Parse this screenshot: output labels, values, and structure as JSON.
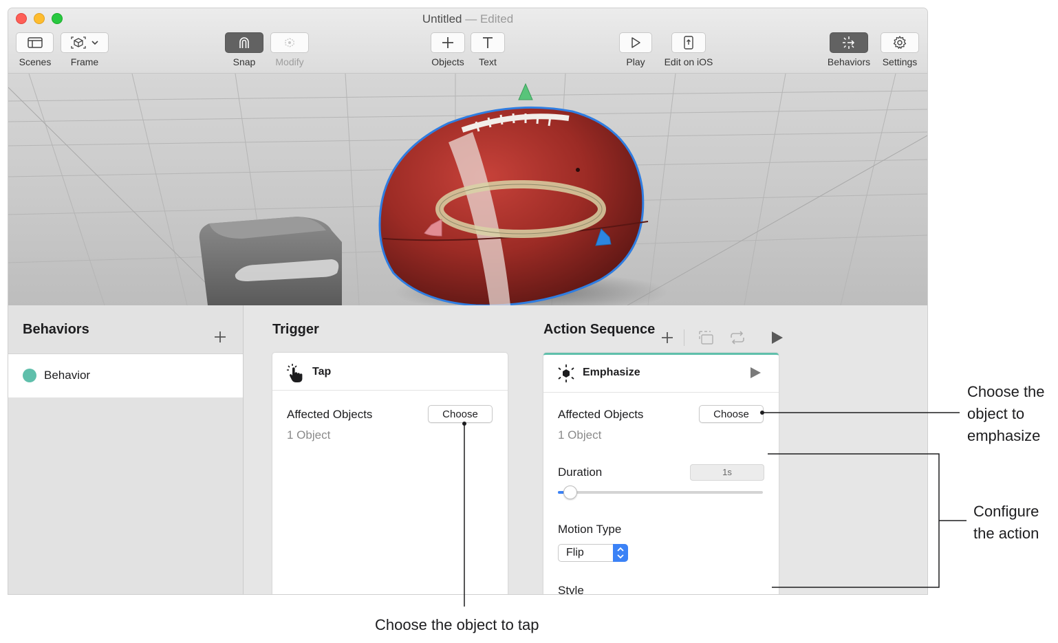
{
  "window": {
    "title": "Untitled",
    "title_suffix": "— Edited"
  },
  "toolbar": {
    "scenes": "Scenes",
    "frame": "Frame",
    "snap": "Snap",
    "modify": "Modify",
    "objects": "Objects",
    "text": "Text",
    "play": "Play",
    "edit_on_ios": "Edit on iOS",
    "behaviors": "Behaviors",
    "settings": "Settings"
  },
  "behaviors_panel": {
    "title": "Behaviors",
    "items": [
      {
        "label": "Behavior",
        "color": "#5fbfab"
      }
    ]
  },
  "trigger": {
    "title": "Trigger",
    "card_title": "Tap",
    "affected_label": "Affected Objects",
    "choose": "Choose",
    "count": "1 Object"
  },
  "action_sequence": {
    "title": "Action Sequence",
    "card_title": "Emphasize",
    "affected_label": "Affected Objects",
    "choose": "Choose",
    "count": "1 Object",
    "duration_label": "Duration",
    "duration_value": "1s",
    "duration_slider_fraction": 0.03,
    "motion_label": "Motion Type",
    "motion_value": "Flip",
    "style_label": "Style",
    "accent": "#5fbfab"
  },
  "callouts": {
    "choose_emphasize": [
      "Choose the",
      "object to",
      "emphasize"
    ],
    "configure": [
      "Configure",
      "the action"
    ],
    "choose_tap": "Choose the object to tap"
  },
  "icons": [
    "sidebar-icon",
    "frame-icon",
    "chevron-down-icon",
    "magnet-icon",
    "modify-icon",
    "plus-icon",
    "text-icon",
    "play-icon",
    "phone-icon",
    "behaviors-icon",
    "gear-icon",
    "tap-icon",
    "emphasize-icon",
    "duplicate-icon",
    "loop-icon"
  ]
}
